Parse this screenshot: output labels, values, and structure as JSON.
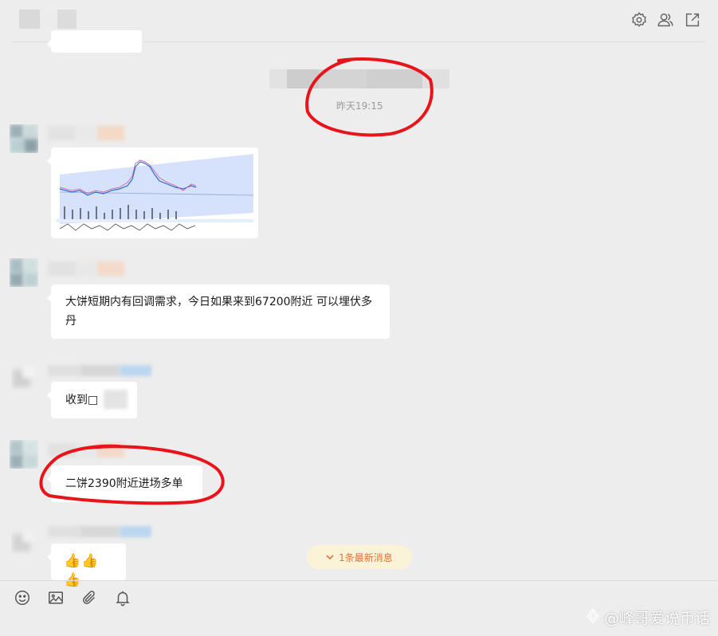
{
  "header": {
    "settings_icon": "gear-icon",
    "members_icon": "users-icon",
    "popout_icon": "external-link-icon"
  },
  "system": {
    "timestamp": "昨天19:15"
  },
  "messages": [
    {
      "type": "image",
      "content": "chart-screenshot"
    },
    {
      "type": "text",
      "text": "大饼短期内有回调需求，今日如果来到67200附近 可以埋伏多丹"
    },
    {
      "type": "text",
      "text": "收到□"
    },
    {
      "type": "text",
      "text": "二饼2390附近进场多单"
    },
    {
      "type": "emoji",
      "text": "👍👍👍"
    }
  ],
  "new_messages_badge": {
    "label": "1条最新消息",
    "icon": "chevron-down-icon"
  },
  "toolbar": {
    "icons": [
      "emoji-icon",
      "image-icon",
      "attachment-icon",
      "bell-icon"
    ]
  },
  "watermark": {
    "text": "@峰哥爱说币话"
  },
  "colors": {
    "annotation": "#e8141a",
    "badge_bg": "#fbf3d7",
    "badge_text": "#e0723a",
    "background": "#ededed"
  }
}
